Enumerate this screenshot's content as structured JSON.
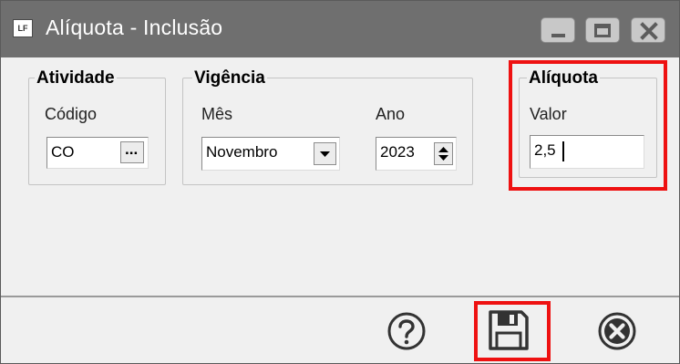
{
  "window": {
    "title": "Alíquota - Inclusão",
    "app_icon_text": "LF",
    "controls": [
      "minimize-icon",
      "maximize-icon",
      "close-icon"
    ]
  },
  "atividade": {
    "group_title": "Atividade",
    "codigo_label": "Código",
    "codigo_value": "CO",
    "lookup_button": "..."
  },
  "vigencia": {
    "group_title": "Vigência",
    "mes_label": "Mês",
    "mes_value": "Novembro",
    "ano_label": "Ano",
    "ano_value": "2023"
  },
  "aliquota": {
    "group_title": "Alíquota",
    "valor_label": "Valor",
    "valor_value": "2,5"
  },
  "footer": {
    "buttons": [
      "help-icon",
      "save-icon",
      "cancel-icon"
    ]
  },
  "colors": {
    "titlebar": "#6f6f6f",
    "highlight": "#ee1111",
    "background": "#f0f0f0"
  }
}
